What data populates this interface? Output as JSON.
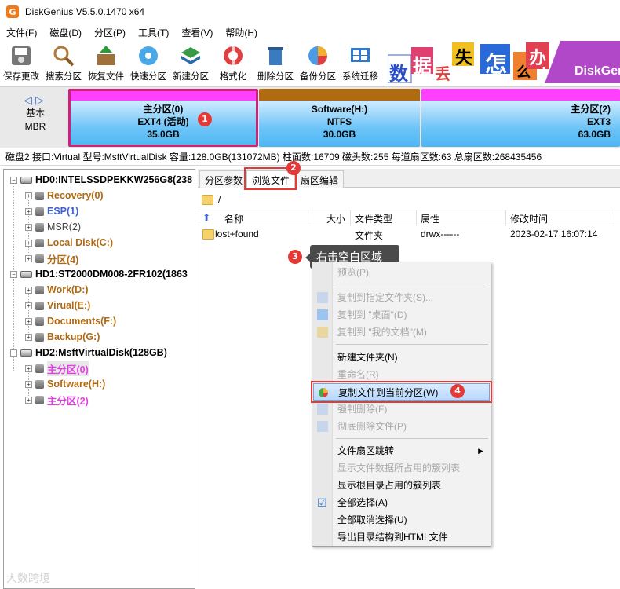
{
  "window": {
    "title": "DiskGenius V5.5.0.1470 x64"
  },
  "menu": [
    "文件(F)",
    "磁盘(D)",
    "分区(P)",
    "工具(T)",
    "查看(V)",
    "帮助(H)"
  ],
  "toolbar": [
    {
      "label": "保存更改",
      "icon": "save-icon",
      "color": "#6a6a6a"
    },
    {
      "label": "搜索分区",
      "icon": "magnifier-icon",
      "color": "#b07a3a"
    },
    {
      "label": "恢复文件",
      "icon": "box-arrow-icon",
      "color": "#2e8b3a"
    },
    {
      "label": "快速分区",
      "icon": "disk-quick-icon",
      "color": "#2a90d8"
    },
    {
      "label": "新建分区",
      "icon": "layers-icon",
      "color": "#3a7a3a"
    },
    {
      "label": "格式化",
      "icon": "lifebuoy-icon",
      "color": "#d83a3a"
    },
    {
      "label": "删除分区",
      "icon": "trash-icon",
      "color": "#3a6fb0"
    },
    {
      "label": "备份分区",
      "icon": "pie-icon",
      "color": "#e08a2a"
    },
    {
      "label": "系统迁移",
      "icon": "windows-icon",
      "color": "#2a7ad8"
    }
  ],
  "banner": {
    "chars": [
      "数",
      "据",
      "丢",
      "失",
      "怎",
      "么",
      "办",
      "!"
    ],
    "brand": "DiskGen"
  },
  "diskmap": {
    "basic_label": "基本",
    "mbr_label": "MBR",
    "partitions": [
      {
        "name": "主分区(0)",
        "fs": "EXT4 (活动)",
        "size": "35.0GB",
        "band_color": "#ff40ff"
      },
      {
        "name": "Software(H:)",
        "fs": "NTFS",
        "size": "30.0GB",
        "band_color": "#b06a12"
      },
      {
        "name": "主分区(2)",
        "fs": "EXT3",
        "size": "63.0GB",
        "band_color": "#ff40ff"
      }
    ]
  },
  "infobar": "磁盘2 接口:Virtual  型号:MsftVirtualDisk  容量:128.0GB(131072MB)  柱面数:16709  磁头数:255  每道扇区数:63  总扇区数:268435456",
  "tree": {
    "disks": [
      {
        "label": "HD0:INTELSSDPEKKW256G8(238",
        "parts": [
          {
            "label": "Recovery(0)",
            "color": "#b06a12"
          },
          {
            "label": "ESP(1)",
            "color": "#3a5fd8"
          },
          {
            "label": "MSR(2)",
            "color": "#444444"
          },
          {
            "label": "Local Disk(C:)",
            "color": "#b06a12"
          },
          {
            "label": "分区(4)",
            "color": "#b06a12"
          }
        ]
      },
      {
        "label": "HD1:ST2000DM008-2FR102(1863",
        "parts": [
          {
            "label": "Work(D:)",
            "color": "#b06a12"
          },
          {
            "label": "Virual(E:)",
            "color": "#b06a12"
          },
          {
            "label": "Documents(F:)",
            "color": "#b06a12"
          },
          {
            "label": "Backup(G:)",
            "color": "#b06a12"
          }
        ]
      },
      {
        "label": "HD2:MsftVirtualDisk(128GB)",
        "parts": [
          {
            "label": "主分区(0)",
            "color": "#e040e0"
          },
          {
            "label": "Software(H:)",
            "color": "#b06a12"
          },
          {
            "label": "主分区(2)",
            "color": "#e040e0"
          }
        ]
      }
    ]
  },
  "tabs": [
    "分区参数",
    "浏览文件",
    "扇区编辑"
  ],
  "path": "/",
  "columns": [
    "名称",
    "大小",
    "文件类型",
    "属性",
    "修改时间"
  ],
  "files": [
    {
      "name": "lost+found",
      "size": "",
      "type": "文件夹",
      "attr": "drwx------",
      "mtime": "2023-02-17 16:07:14"
    }
  ],
  "tooltip": "右击空白区域",
  "context_menu": {
    "preview": "预览(P)",
    "copy_to_folder": "复制到指定文件夹(S)...",
    "copy_to_desktop": "复制到 \"桌面\"(D)",
    "copy_to_documents": "复制到 \"我的文档\"(M)",
    "new_folder": "新建文件夹(N)",
    "rename": "重命名(R)",
    "copy_to_current": "复制文件到当前分区(W)",
    "force_delete": "强制删除(F)",
    "wipe_delete": "彻底删除文件(P)",
    "sector_jump": "文件扇区跳转",
    "show_clusters": "显示文件数据所占用的簇列表",
    "show_root_clusters": "显示根目录占用的簇列表",
    "select_all": "全部选择(A)",
    "deselect_all": "全部取消选择(U)",
    "export_html": "导出目录结构到HTML文件"
  },
  "badges": [
    "1",
    "2",
    "3",
    "4"
  ],
  "watermark": "大数跨境"
}
